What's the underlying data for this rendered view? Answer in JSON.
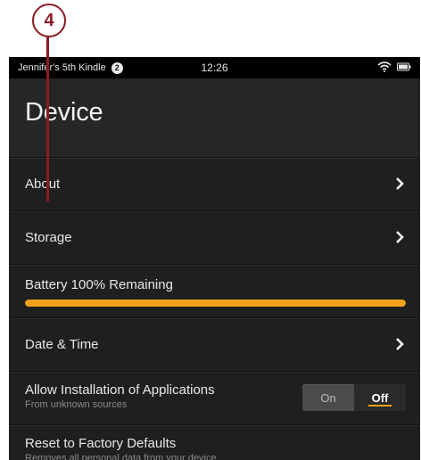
{
  "callout": {
    "number": "4"
  },
  "statusbar": {
    "device_name": "Jennifer's 5th Kindle",
    "notification_count": "2",
    "time": "12:26",
    "icons": [
      "wifi-icon",
      "battery-icon"
    ]
  },
  "header": {
    "title": "Device"
  },
  "rows": {
    "about": {
      "label": "About",
      "icon": "chevron-right-icon"
    },
    "storage": {
      "label": "Storage",
      "icon": "chevron-right-icon"
    },
    "battery": {
      "label": "Battery 100% Remaining",
      "level": 1.0,
      "color": "#f1a21a"
    },
    "date_time": {
      "label": "Date & Time",
      "icon": "chevron-right-icon"
    },
    "install_apps": {
      "label": "Allow Installation of Applications",
      "sublabel": "From unknown sources",
      "toggle": {
        "on_label": "On",
        "off_label": "Off",
        "selected": "Off"
      }
    },
    "factory_reset": {
      "label": "Reset to Factory Defaults",
      "sublabel": "Removes all personal data from your device"
    }
  },
  "colors": {
    "accent": "#f1a21a",
    "callout": "#8a1c22",
    "background": "#1f1f1f"
  }
}
